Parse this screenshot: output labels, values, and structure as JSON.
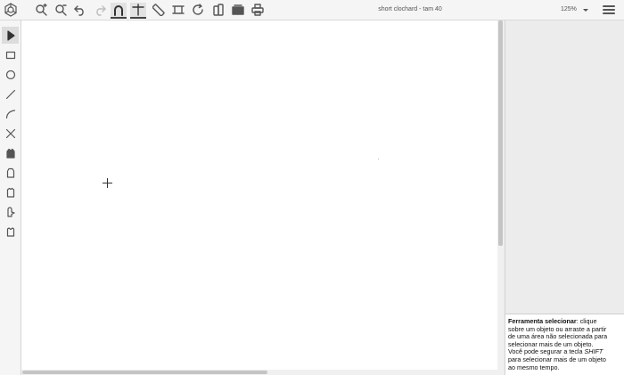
{
  "toolbar": {
    "document_title": "short clochard - tam 40",
    "zoom_value": "125%",
    "buttons": [
      {
        "name": "zoom-in-icon"
      },
      {
        "name": "zoom-out-icon"
      },
      {
        "name": "undo-icon"
      },
      {
        "name": "redo-icon"
      },
      {
        "name": "magnet-icon"
      },
      {
        "name": "ruler-t-icon"
      },
      {
        "name": "measure-icon"
      },
      {
        "name": "select-region-icon"
      },
      {
        "name": "rotate-icon"
      },
      {
        "name": "layers-icon"
      },
      {
        "name": "print-preview-icon"
      },
      {
        "name": "print-icon"
      }
    ]
  },
  "left_tools": [
    {
      "name": "select-tool-icon"
    },
    {
      "name": "rectangle-tool-icon"
    },
    {
      "name": "circle-tool-icon"
    },
    {
      "name": "line-tool-icon"
    },
    {
      "name": "curve-tool-icon"
    },
    {
      "name": "delete-tool-icon"
    },
    {
      "name": "bodice-tool-icon"
    },
    {
      "name": "front-piece-tool-icon"
    },
    {
      "name": "back-piece-tool-icon"
    },
    {
      "name": "sleeve-tool-icon"
    },
    {
      "name": "collar-tool-icon"
    }
  ],
  "help": {
    "tool_name": "Ferramenta selecionar",
    "line1_rest": ": clique",
    "line2": "sobre um objeto ou arraste a partir",
    "line3": "de uma área não selecionada para",
    "line4": "selecionar mais de um objeto.",
    "line5_pre": "Você pode segurar a tecla ",
    "key": "SHIFT",
    "line6": "para selecionar mais de um objeto",
    "line7": "ao mesmo tempo."
  },
  "colors": {
    "toolbar_bg": "#f5f5f5",
    "canvas_bg": "#ffffff",
    "panel_bg": "#ececec",
    "icon": "#555555"
  }
}
